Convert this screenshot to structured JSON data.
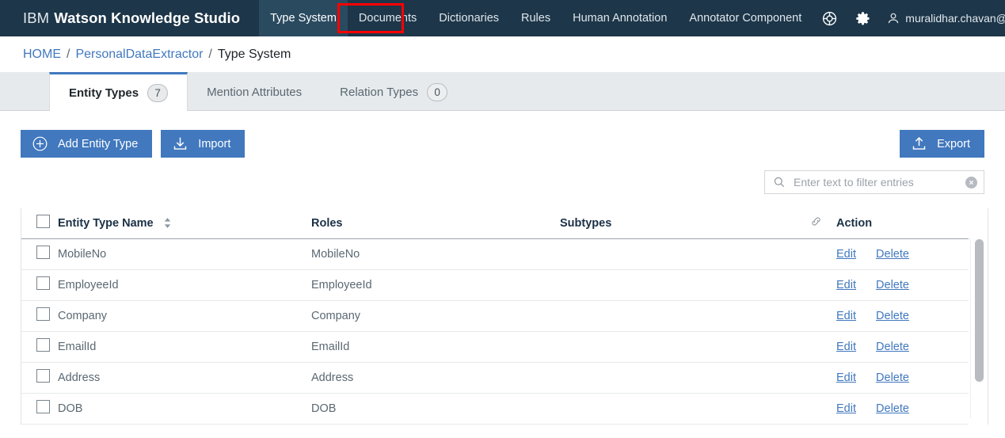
{
  "topnav": {
    "brand_ibm": "IBM",
    "brand_product": "Watson Knowledge Studio",
    "items": [
      {
        "label": "Type System",
        "active": true
      },
      {
        "label": "Documents",
        "active": false,
        "highlighted": true
      },
      {
        "label": "Dictionaries",
        "active": false
      },
      {
        "label": "Rules",
        "active": false
      },
      {
        "label": "Human Annotation",
        "active": false
      },
      {
        "label": "Annotator Component",
        "active": false
      }
    ],
    "help_icon": "lifebuoy-icon",
    "settings_icon": "gear-icon",
    "user_icon": "person-icon",
    "user_email": "muralidhar.chavan@in.ibm.com",
    "highlight_color": "#ff0000",
    "background_color": "#1d3649"
  },
  "breadcrumb": {
    "home": "HOME",
    "project": "PersonalDataExtractor",
    "current": "Type System",
    "separator": "/",
    "link_color": "#4178be"
  },
  "tabs": [
    {
      "label": "Entity Types",
      "badge": "7",
      "active": true
    },
    {
      "label": "Mention Attributes",
      "badge": null,
      "active": false
    },
    {
      "label": "Relation Types",
      "badge": "0",
      "active": false
    }
  ],
  "toolbar": {
    "add_entity_label": "Add Entity Type",
    "add_entity_icon": "circle-plus-icon",
    "import_label": "Import",
    "import_icon": "download-icon",
    "export_label": "Export",
    "export_icon": "upload-icon",
    "button_color": "#4178be"
  },
  "search": {
    "placeholder": "Enter text to filter entries",
    "value": "",
    "search_icon": "search-icon",
    "clear_icon": "clear-circle-icon"
  },
  "table": {
    "columns": {
      "select_all": "",
      "name": "Entity Type Name",
      "roles": "Roles",
      "subtypes": "Subtypes",
      "link": "",
      "action": "Action"
    },
    "sort_icon": "sort-arrows-icon",
    "link_icon": "chain-link-icon",
    "edit_label": "Edit",
    "delete_label": "Delete",
    "rows": [
      {
        "name": "MobileNo",
        "roles": "MobileNo",
        "subtypes": ""
      },
      {
        "name": "EmployeeId",
        "roles": "EmployeeId",
        "subtypes": ""
      },
      {
        "name": "Company",
        "roles": "Company",
        "subtypes": ""
      },
      {
        "name": "EmailId",
        "roles": "EmailId",
        "subtypes": ""
      },
      {
        "name": "Address",
        "roles": "Address",
        "subtypes": ""
      },
      {
        "name": "DOB",
        "roles": "DOB",
        "subtypes": ""
      }
    ]
  }
}
